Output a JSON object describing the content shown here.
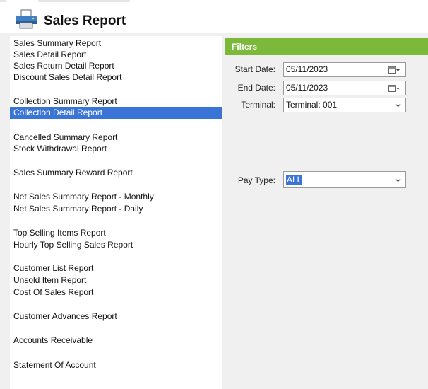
{
  "window": {
    "title": "Sales Report",
    "title_icon": "printer-icon"
  },
  "reports": [
    {
      "label": "Sales Summary Report",
      "selected": false
    },
    {
      "label": "Sales Detail Report",
      "selected": false
    },
    {
      "label": "Sales Return Detail Report",
      "selected": false
    },
    {
      "label": "Discount Sales Detail Report",
      "selected": false
    },
    {
      "label": "Collection Summary Report",
      "selected": false
    },
    {
      "label": "Collection Detail Report",
      "selected": true
    },
    {
      "label": "Cancelled Summary Report",
      "selected": false
    },
    {
      "label": "Stock Withdrawal Report",
      "selected": false
    },
    {
      "label": "Sales Summary Reward Report",
      "selected": false
    },
    {
      "label": "Net Sales Summary Report - Monthly",
      "selected": false
    },
    {
      "label": "Net Sales Summary Report - Daily",
      "selected": false
    },
    {
      "label": "Top Selling Items Report",
      "selected": false
    },
    {
      "label": "Hourly Top Selling Sales Report",
      "selected": false
    },
    {
      "label": "Customer List Report",
      "selected": false
    },
    {
      "label": "Unsold Item Report",
      "selected": false
    },
    {
      "label": "Cost Of Sales Report",
      "selected": false
    },
    {
      "label": "Customer Advances Report",
      "selected": false
    },
    {
      "label": "Accounts Receivable",
      "selected": false
    },
    {
      "label": "Statement Of Account",
      "selected": false
    }
  ],
  "filters": {
    "title": "Filters",
    "start_date": {
      "label": "Start Date:",
      "value": "05/11/2023",
      "icon": "calendar-dropdown-icon"
    },
    "end_date": {
      "label": "End Date:",
      "value": "05/11/2023",
      "icon": "calendar-dropdown-icon"
    },
    "terminal": {
      "label": "Terminal:",
      "value": "Terminal: 001",
      "icon": "chevron-down-icon"
    },
    "pay_type": {
      "label": "Pay Type:",
      "value": "ALL",
      "icon": "chevron-down-icon"
    }
  },
  "colors": {
    "accent_green": "#7cb93a",
    "selection_blue": "#3b74d7"
  }
}
